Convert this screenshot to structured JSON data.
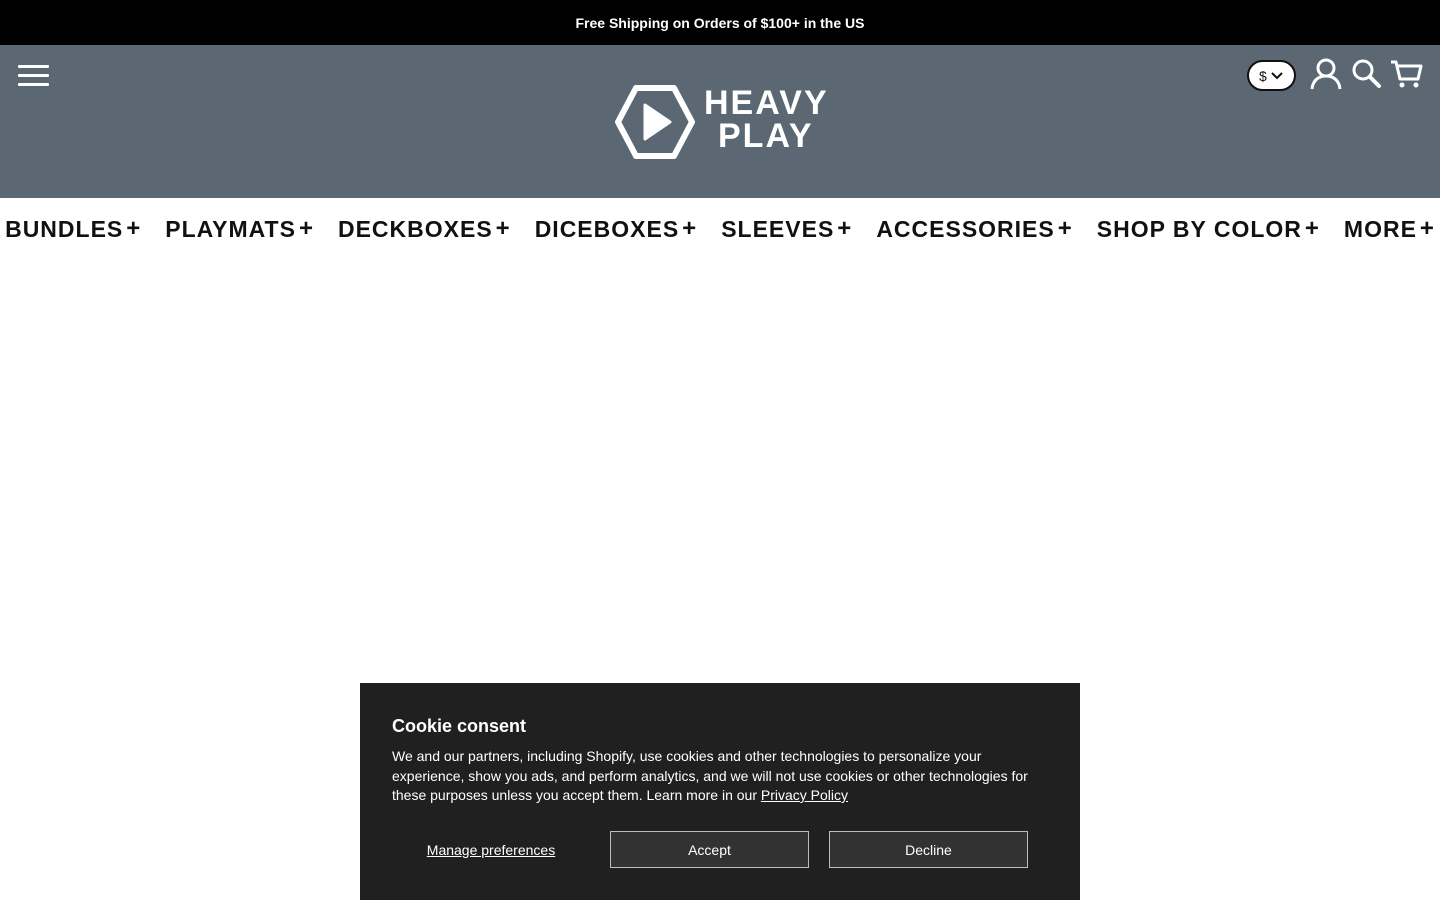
{
  "announcement": {
    "text": "Free Shipping on Orders of $100+ in the US"
  },
  "header": {
    "logo": {
      "line1": "HEAVY",
      "line2": "PLAY"
    },
    "currency": {
      "symbol": "$"
    },
    "icons": [
      "menu-icon",
      "user-icon",
      "search-icon",
      "cart-icon"
    ]
  },
  "nav": {
    "items": [
      {
        "label": "BUNDLES",
        "expand": "+"
      },
      {
        "label": "PLAYMATS",
        "expand": "+"
      },
      {
        "label": "DECKBOXES",
        "expand": "+"
      },
      {
        "label": "DICEBOXES",
        "expand": "+"
      },
      {
        "label": "SLEEVES",
        "expand": "+"
      },
      {
        "label": "ACCESSORIES",
        "expand": "+"
      },
      {
        "label": "SHOP BY COLOR",
        "expand": "+"
      },
      {
        "label": "MORE",
        "expand": "+"
      }
    ]
  },
  "cookie": {
    "title": "Cookie consent",
    "body": "We and our partners, including Shopify, use cookies and other technologies to personalize your experience, show you ads, and perform analytics, and we will not use cookies or other technologies for these purposes unless you accept them. Learn more in our ",
    "link": "Privacy Policy",
    "manage": "Manage preferences",
    "accept": "Accept",
    "decline": "Decline"
  },
  "colors": {
    "header_bg": "#5b6772",
    "announcement_bg": "#000000",
    "cookie_bg": "#202020"
  }
}
